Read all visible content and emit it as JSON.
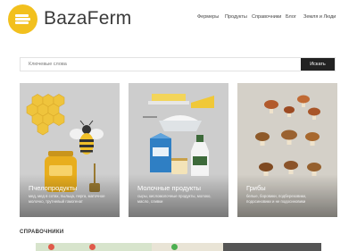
{
  "brand": {
    "name": "BazaFerm",
    "accent": "#f2c01e"
  },
  "nav": [
    {
      "label": "Фермеры"
    },
    {
      "label": "Продукты"
    },
    {
      "label": "Справочники"
    },
    {
      "label": "Блог"
    },
    {
      "label": "Земля и Люди"
    }
  ],
  "search": {
    "placeholder": "Ключевые слова",
    "button_label": "Искать"
  },
  "cards": [
    {
      "title": "Пчелопродукты",
      "desc": "мед, мед в сотах, пыльца, перга, маточное молочко, трутневый гомогенат",
      "icon": "bee-honey-illustration"
    },
    {
      "title": "Молочные продукты",
      "desc": "сыры, кисломолочные продукты, молоко, масло, сливки",
      "icon": "dairy-illustration"
    },
    {
      "title": "Грибы",
      "desc": "белые, боровики, подберезовики, подосиновики и не подосиновики",
      "icon": "mushrooms-illustration"
    }
  ],
  "section": {
    "title": "СПРАВОЧНИКИ"
  }
}
